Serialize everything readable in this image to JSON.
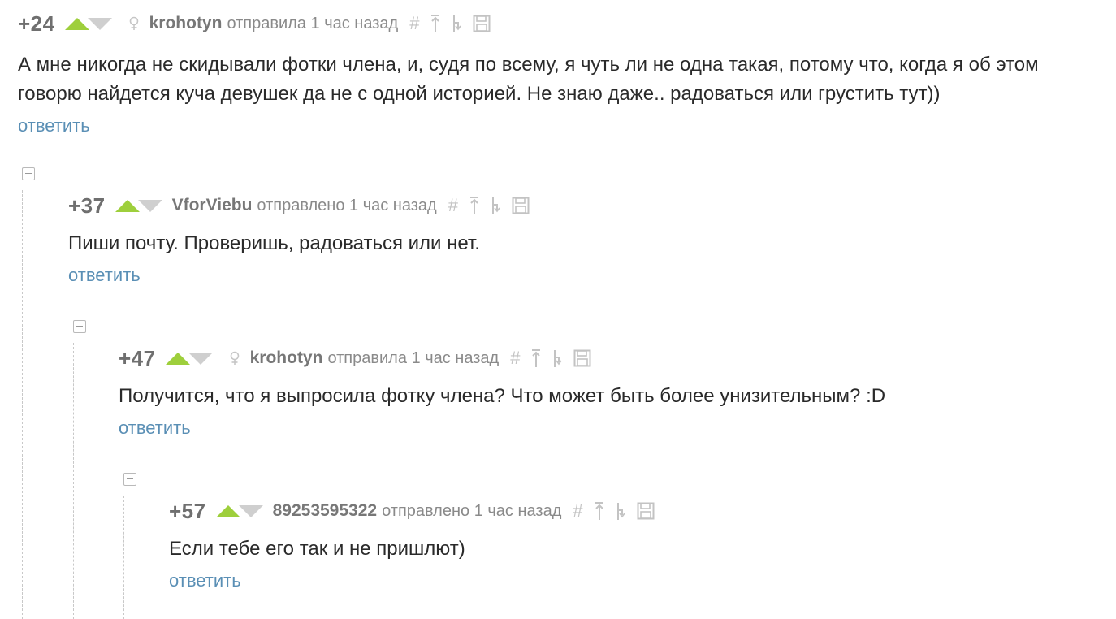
{
  "comments": [
    {
      "rating": "+24",
      "author": "krohotyn",
      "sent": "отправила 1 час назад",
      "gender": "female",
      "text": "А мне никогда не скидывали фотки члена, и, судя по всему, я чуть ли не одна такая, потому что, когда я об этом говорю найдется куча девушек да не с одной историей. Не знаю даже.. радоваться или грустить тут))",
      "reply": "ответить"
    },
    {
      "rating": "+37",
      "author": "VforViebu",
      "sent": "отправлено 1 час назад",
      "gender": "",
      "text": "Пиши почту. Проверишь, радоваться или нет.",
      "reply": "ответить"
    },
    {
      "rating": "+47",
      "author": "krohotyn",
      "sent": "отправила 1 час назад",
      "gender": "female",
      "text": "Получится, что я выпросила фотку члена? Что может быть более унизительным? :D",
      "reply": "ответить"
    },
    {
      "rating": "+57",
      "author": "89253595322",
      "sent": "отправлено 1 час назад",
      "gender": "",
      "text": "Если тебе его так и не пришлют)",
      "reply": "ответить"
    }
  ],
  "icons": {
    "upvote": "arrow-up-icon",
    "downvote": "arrow-down-icon",
    "gender": "female-icon",
    "link": "hash-icon",
    "parent": "go-to-parent-icon",
    "branch": "branch-icon",
    "save": "save-icon"
  },
  "colors": {
    "upvote": "#9ecf3c",
    "downvote": "#cfcfcf",
    "reply_link": "#5a8fb5",
    "rating": "#6f6f6f",
    "author": "#777777",
    "icon": "#c3c3c3"
  }
}
